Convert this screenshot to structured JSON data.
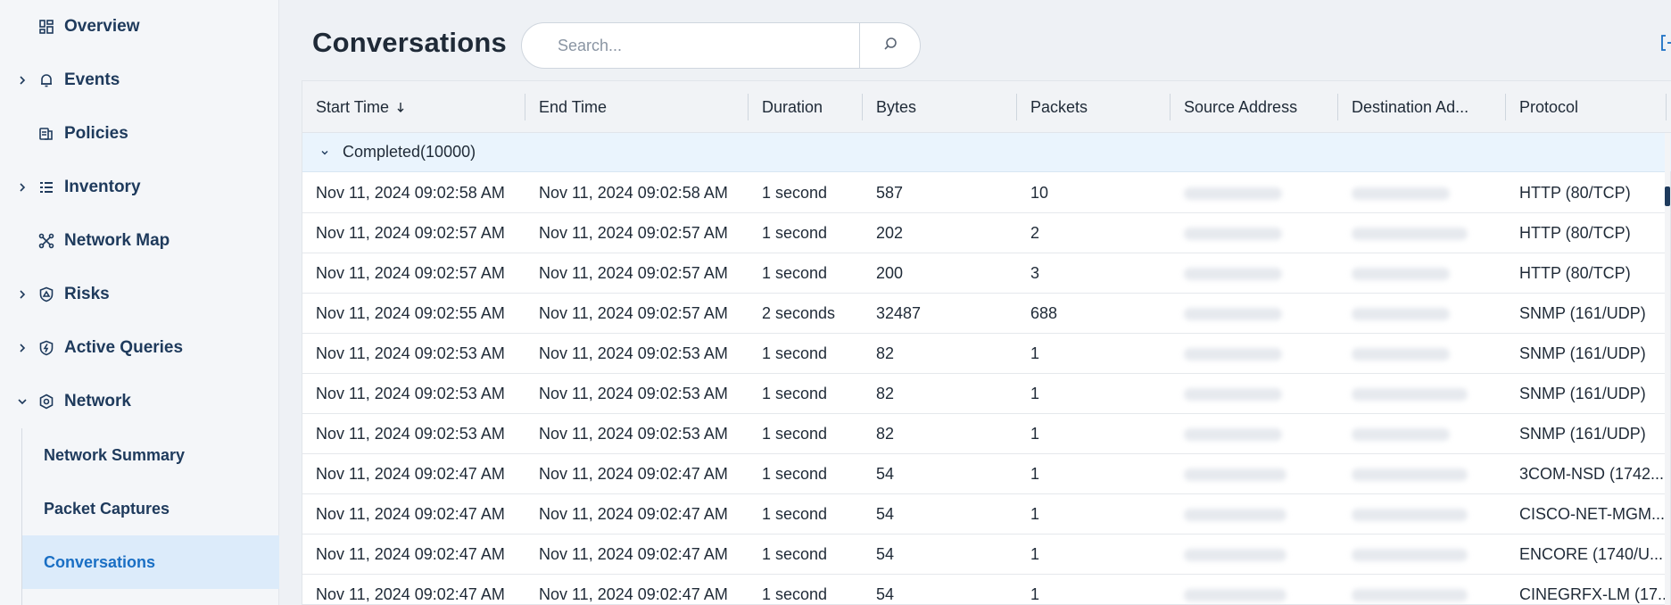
{
  "sidebar": {
    "items": [
      {
        "label": "Overview",
        "icon": "overview-icon",
        "chevron": false
      },
      {
        "label": "Events",
        "icon": "bell-icon",
        "chevron": true
      },
      {
        "label": "Policies",
        "icon": "policies-icon",
        "chevron": false
      },
      {
        "label": "Inventory",
        "icon": "list-icon",
        "chevron": true
      },
      {
        "label": "Network Map",
        "icon": "network-map-icon",
        "chevron": false
      },
      {
        "label": "Risks",
        "icon": "risk-shield-icon",
        "chevron": true
      },
      {
        "label": "Active Queries",
        "icon": "bolt-shield-icon",
        "chevron": true
      },
      {
        "label": "Network",
        "icon": "network-gear-icon",
        "chevron": "expanded"
      }
    ],
    "subitems": [
      {
        "label": "Network Summary",
        "active": false
      },
      {
        "label": "Packet Captures",
        "active": false
      },
      {
        "label": "Conversations",
        "active": true
      }
    ]
  },
  "page": {
    "title": "Conversations",
    "search_placeholder": "Search..."
  },
  "table": {
    "columns": [
      "Start Time",
      "End Time",
      "Duration",
      "Bytes",
      "Packets",
      "Source Address",
      "Destination Ad...",
      "Protocol"
    ],
    "sort_column": "Start Time",
    "sort_direction": "descending",
    "group": {
      "label": "Completed",
      "count": "(10000)"
    },
    "rows": [
      [
        "Nov 11, 2024 09:02:58 AM",
        "Nov 11, 2024 09:02:58 AM",
        "1 second",
        "587",
        "10",
        "",
        "",
        "HTTP (80/TCP)"
      ],
      [
        "Nov 11, 2024 09:02:57 AM",
        "Nov 11, 2024 09:02:57 AM",
        "1 second",
        "202",
        "2",
        "",
        "",
        "HTTP (80/TCP)"
      ],
      [
        "Nov 11, 2024 09:02:57 AM",
        "Nov 11, 2024 09:02:57 AM",
        "1 second",
        "200",
        "3",
        "",
        "",
        "HTTP (80/TCP)"
      ],
      [
        "Nov 11, 2024 09:02:55 AM",
        "Nov 11, 2024 09:02:57 AM",
        "2 seconds",
        "32487",
        "688",
        "",
        "",
        "SNMP (161/UDP)"
      ],
      [
        "Nov 11, 2024 09:02:53 AM",
        "Nov 11, 2024 09:02:53 AM",
        "1 second",
        "82",
        "1",
        "",
        "",
        "SNMP (161/UDP)"
      ],
      [
        "Nov 11, 2024 09:02:53 AM",
        "Nov 11, 2024 09:02:53 AM",
        "1 second",
        "82",
        "1",
        "",
        "",
        "SNMP (161/UDP)"
      ],
      [
        "Nov 11, 2024 09:02:53 AM",
        "Nov 11, 2024 09:02:53 AM",
        "1 second",
        "82",
        "1",
        "",
        "",
        "SNMP (161/UDP)"
      ],
      [
        "Nov 11, 2024 09:02:47 AM",
        "Nov 11, 2024 09:02:47 AM",
        "1 second",
        "54",
        "1",
        "",
        "",
        "3COM-NSD (1742..."
      ],
      [
        "Nov 11, 2024 09:02:47 AM",
        "Nov 11, 2024 09:02:47 AM",
        "1 second",
        "54",
        "1",
        "",
        "",
        "CISCO-NET-MGM..."
      ],
      [
        "Nov 11, 2024 09:02:47 AM",
        "Nov 11, 2024 09:02:47 AM",
        "1 second",
        "54",
        "1",
        "",
        "",
        "ENCORE (1740/U..."
      ],
      [
        "Nov 11, 2024 09:02:47 AM",
        "Nov 11, 2024 09:02:47 AM",
        "1 second",
        "54",
        "1",
        "",
        "",
        "CINEGRFX-LM (17..."
      ]
    ]
  },
  "colors": {
    "accent": "#1a6fc4",
    "nav_text": "#1e3a5c",
    "active_bg": "#dcebfa",
    "group_bg": "#eaf4fd"
  }
}
